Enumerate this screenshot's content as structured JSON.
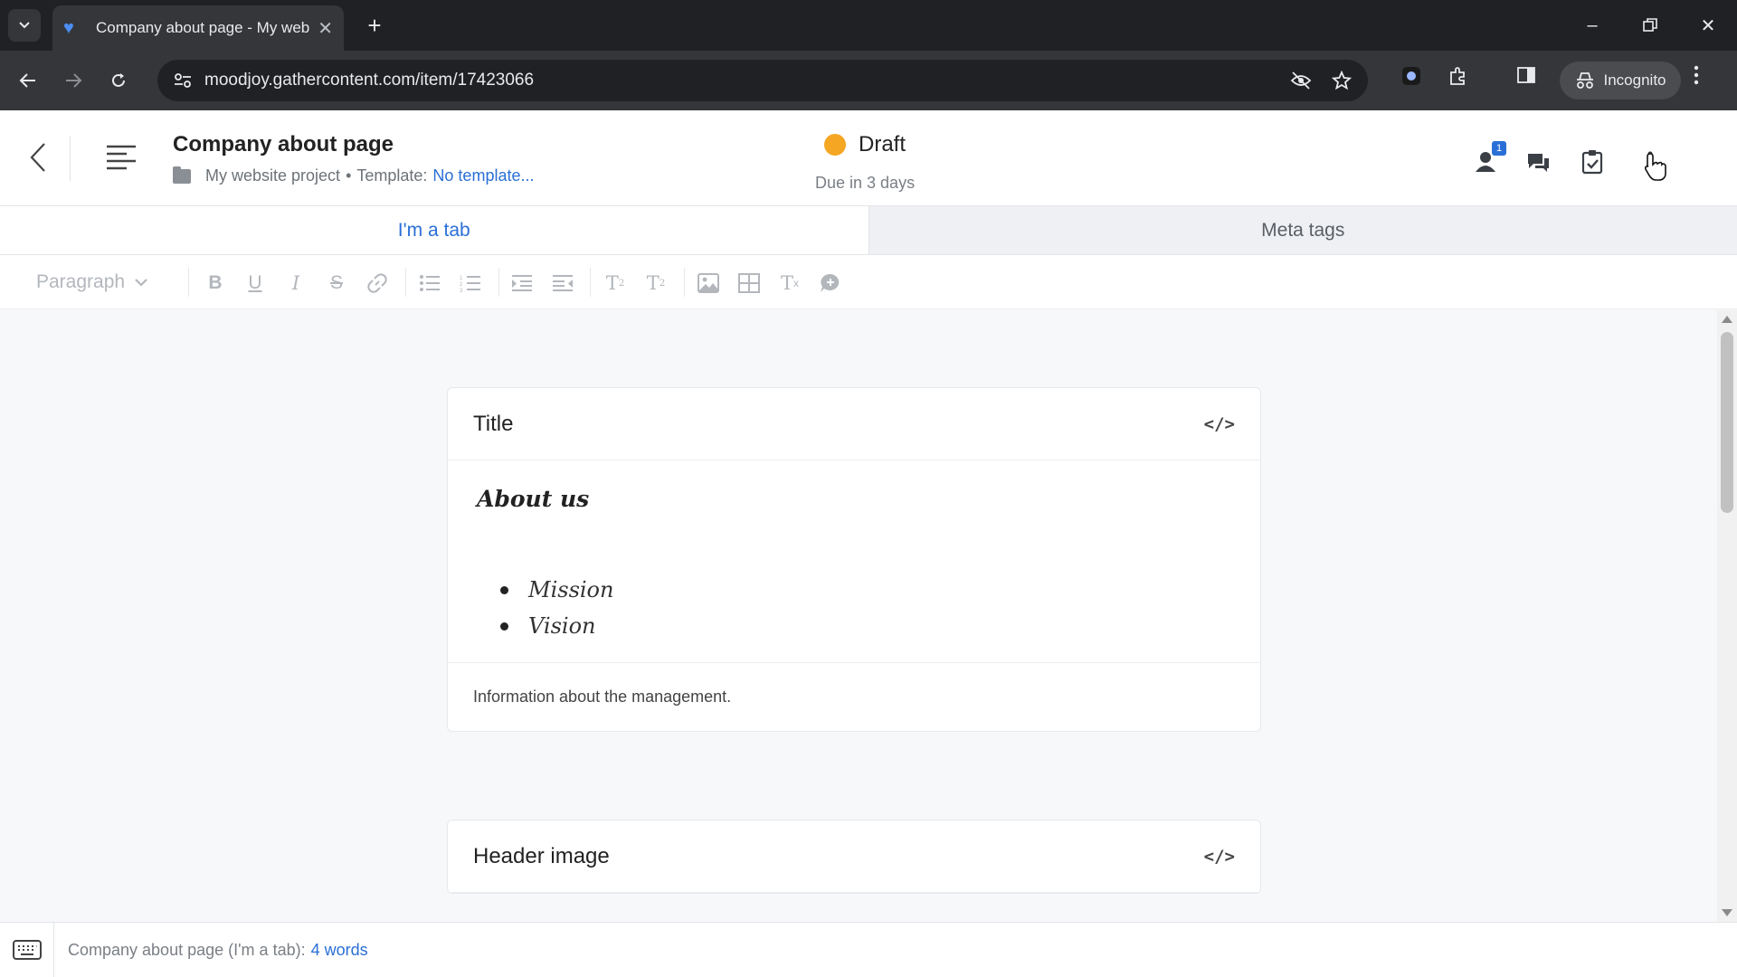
{
  "browser": {
    "tab_title": "Company about page - My web",
    "url": "moodjoy.gathercontent.com/item/17423066",
    "profile_label": "Incognito"
  },
  "header": {
    "item_title": "Company about page",
    "project": "My website project",
    "separator": "•",
    "template_label": "Template:",
    "template_value": "No template...",
    "status": "Draft",
    "status_color": "#f5a623",
    "due": "Due in 3 days",
    "assignee_badge": "1"
  },
  "tabs": [
    {
      "label": "I'm a tab",
      "active": true
    },
    {
      "label": "Meta tags",
      "active": false
    }
  ],
  "editor_toolbar": {
    "paragraph_select": "Paragraph",
    "buttons": [
      "bold-icon",
      "underline-icon",
      "italic-icon",
      "strikethrough-icon",
      "link-icon",
      "bullet-list-icon",
      "numbered-list-icon",
      "indent-icon",
      "outdent-icon",
      "subscript-icon",
      "superscript-icon",
      "image-icon",
      "table-icon",
      "clear-format-icon",
      "comment-icon"
    ]
  },
  "fields": [
    {
      "name": "Title",
      "heading": "About us",
      "list": [
        "Mission",
        "Vision"
      ],
      "description": "Information about the management."
    },
    {
      "name": "Header image"
    }
  ],
  "statusbar": {
    "summary": "Company about page (I'm a tab):",
    "word_count": "4 words"
  },
  "accent_color": "#2a6fd6"
}
